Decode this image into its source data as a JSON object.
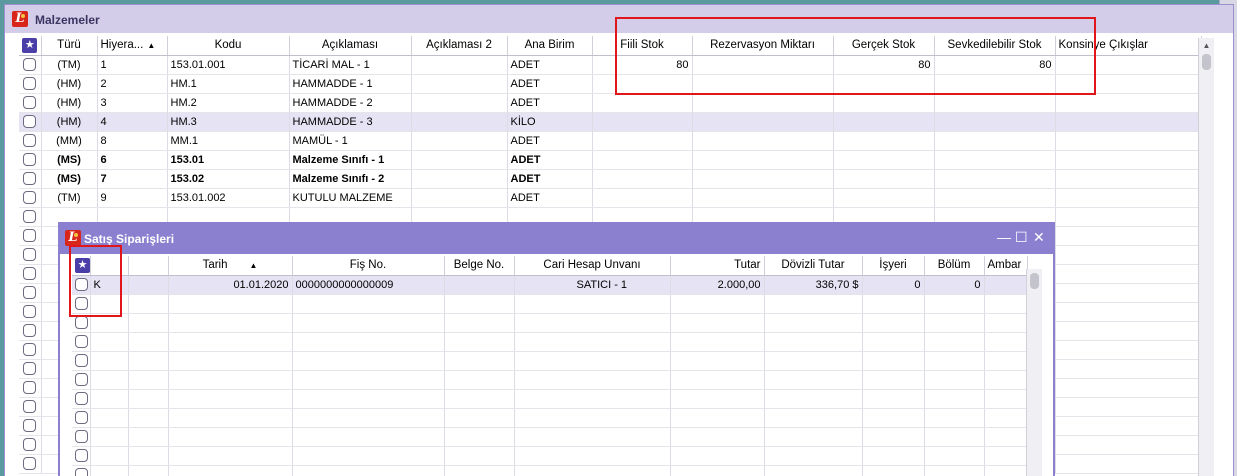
{
  "main": {
    "title": "Malzemeler",
    "columns": [
      "Türü",
      "Hiyera...",
      "Kodu",
      "Açıklaması",
      "Açıklaması 2",
      "Ana Birim",
      "Fiili Stok",
      "Rezervasyon Miktarı",
      "Gerçek Stok",
      "Sevkedilebilir Stok",
      "Konsinye Çıkışlar"
    ],
    "rows": [
      {
        "turu": "(TM)",
        "hiyerarsi": "1",
        "kodu": "153.01.001",
        "aciklama": "TİCARİ MAL - 1",
        "aciklama2": "",
        "birim": "ADET",
        "fiili": "80",
        "rezervasyon": "",
        "gercek": "80",
        "sevk": "80",
        "konsinye": ""
      },
      {
        "turu": "(HM)",
        "hiyerarsi": "2",
        "kodu": "HM.1",
        "aciklama": "HAMMADDE - 1",
        "aciklama2": "",
        "birim": "ADET",
        "fiili": "",
        "rezervasyon": "",
        "gercek": "",
        "sevk": "",
        "konsinye": ""
      },
      {
        "turu": "(HM)",
        "hiyerarsi": "3",
        "kodu": "HM.2",
        "aciklama": "HAMMADDE - 2",
        "aciklama2": "",
        "birim": "ADET",
        "fiili": "",
        "rezervasyon": "",
        "gercek": "",
        "sevk": "",
        "konsinye": ""
      },
      {
        "turu": "(HM)",
        "hiyerarsi": "4",
        "kodu": "HM.3",
        "aciklama": "HAMMADDE - 3",
        "aciklama2": "",
        "birim": "KİLO",
        "fiili": "",
        "rezervasyon": "",
        "gercek": "",
        "sevk": "",
        "konsinye": ""
      },
      {
        "turu": "(MM)",
        "hiyerarsi": "8",
        "kodu": "MM.1",
        "aciklama": "MAMÜL - 1",
        "aciklama2": "",
        "birim": "ADET",
        "fiili": "",
        "rezervasyon": "",
        "gercek": "",
        "sevk": "",
        "konsinye": ""
      },
      {
        "turu": "(MS)",
        "hiyerarsi": "6",
        "kodu": "153.01",
        "aciklama": "Malzeme Sınıfı - 1",
        "aciklama2": "",
        "birim": "ADET",
        "fiili": "",
        "rezervasyon": "",
        "gercek": "",
        "sevk": "",
        "konsinye": ""
      },
      {
        "turu": "(MS)",
        "hiyerarsi": "7",
        "kodu": "153.02",
        "aciklama": "Malzeme Sınıfı - 2",
        "aciklama2": "",
        "birim": "ADET",
        "fiili": "",
        "rezervasyon": "",
        "gercek": "",
        "sevk": "",
        "konsinye": ""
      },
      {
        "turu": "(TM)",
        "hiyerarsi": "9",
        "kodu": "153.01.002",
        "aciklama": "KUTULU MALZEME",
        "aciklama2": "",
        "birim": "ADET",
        "fiili": "",
        "rezervasyon": "",
        "gercek": "",
        "sevk": "",
        "konsinye": ""
      }
    ]
  },
  "orders": {
    "title": "Satış Siparişleri",
    "columns": [
      "",
      "Tarih",
      "Fiş No.",
      "Belge No.",
      "Cari Hesap Unvanı",
      "Tutar",
      "Dövizli Tutar",
      "İşyeri",
      "Bölüm",
      "Ambar"
    ],
    "rows": [
      {
        "k": "K",
        "tarih": "01.01.2020",
        "fis": "0000000000000009",
        "belge": "",
        "cari": "SATICI - 1",
        "tutar": "2.000,00",
        "doviz": "336,70 $",
        "isyeri": "0",
        "bolum": "0",
        "ambar": ""
      }
    ]
  },
  "icons": {
    "logo": "logo-icon",
    "star": "star-icon",
    "minimize": "minimize-icon",
    "maximize": "maximize-icon",
    "close": "close-icon"
  },
  "colors": {
    "highlight": "#e0161b",
    "accent": "#8b7fd0",
    "selected_row": "#e6e3f4"
  }
}
